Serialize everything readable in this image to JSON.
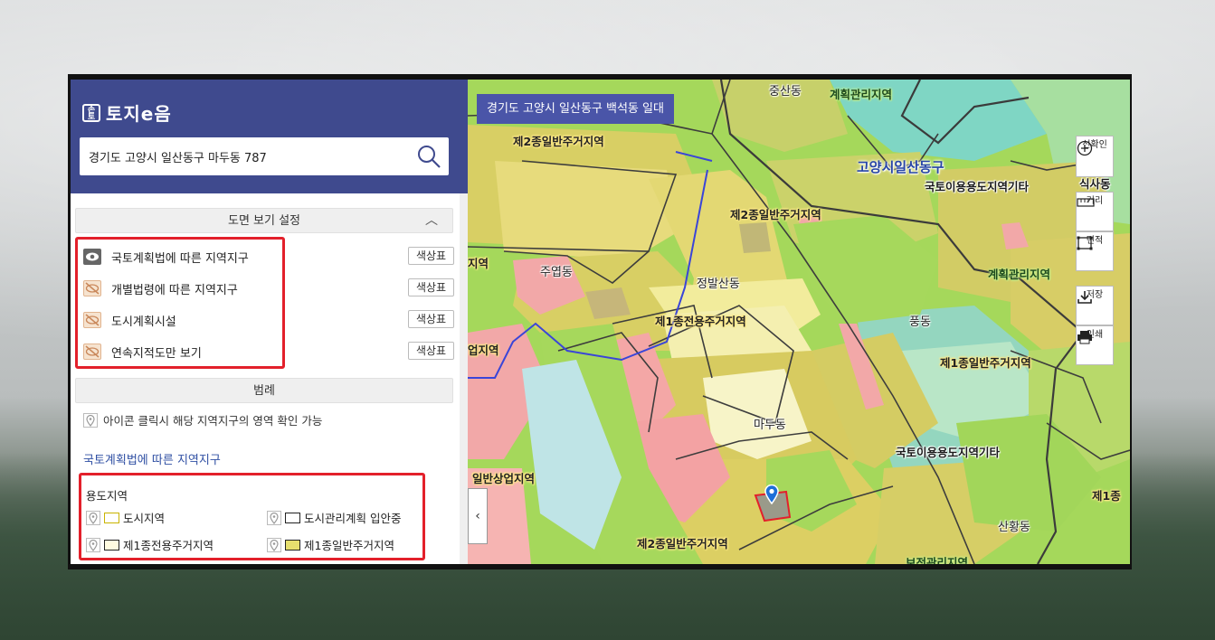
{
  "app": {
    "logo_text": "토지e음",
    "logo_mark": "손쉽\n토지"
  },
  "search": {
    "value": "경기도 고양시 일산동구 마두동 787",
    "icon": "search-icon"
  },
  "view_settings": {
    "title": "도면 보기 설정",
    "layers": [
      {
        "label": "국토계획법에 따른 지역지구",
        "visible": true,
        "button": "색상표"
      },
      {
        "label": "개별법령에 따른 지역지구",
        "visible": false,
        "button": "색상표"
      },
      {
        "label": "도시계획시설",
        "visible": false,
        "button": "색상표"
      },
      {
        "label": "연속지적도만 보기",
        "visible": false,
        "button": "색상표"
      }
    ]
  },
  "legend": {
    "title": "범례",
    "info": "아이콘 클릭시 해당 지역지구의 영역 확인 가능",
    "subheading": "국토계획법에 따른 지역지구",
    "group_title": "용도지역",
    "items": [
      {
        "label": "도시지역",
        "swatch": "#ffffff",
        "border": "#c9b400"
      },
      {
        "label": "도시관리계획 입안중",
        "swatch": "#ffffff",
        "border": "#222222"
      },
      {
        "label": "제1종전용주거지역",
        "swatch": "#fffbe0",
        "border": "#222222"
      },
      {
        "label": "제1종일반주거지역",
        "swatch": "#e6df6e",
        "border": "#222222"
      }
    ]
  },
  "map": {
    "title": "경기도 고양시 일산동구 백석동 일대",
    "tools": [
      {
        "label": "선확인",
        "icon": "plus-circle-icon"
      },
      {
        "label": "거리",
        "icon": "ruler-icon"
      },
      {
        "label": "면적",
        "icon": "area-icon"
      },
      {
        "label": "저장",
        "icon": "download-icon"
      },
      {
        "label": "인쇄",
        "icon": "printer-icon"
      }
    ],
    "collapse_icon": "chevron-left-icon",
    "labels": {
      "jungsan": "중산동",
      "gyehoek_top": "계획관리지역",
      "zone2_top": "제2종일반주거지역",
      "ilsan_dong_gu": "고양시일산동구",
      "seoksadong": "식사동",
      "national_land_top": "국토이용용도지역기타",
      "zone2_mid": "제2종일반주거지역",
      "juyeop": "주엽동",
      "jeongbalsan": "정발산동",
      "gyehoek_right": "계획관리지역",
      "zone1_exclusive": "제1종전용주거지역",
      "pungdong": "풍동",
      "zone1_general": "제1종일반주거지역",
      "left_cut": "지역",
      "left_cut2": "업지역",
      "madu": "마두동",
      "national_land_mid": "국토이용용도지역기타",
      "general_commercial": "일반상업지역",
      "zone1_right": "제1종",
      "sanhwang": "산황동",
      "zone2_bottom": "제2종일반주거지역",
      "nature_bottom": "보전관리지역"
    }
  },
  "colors": {
    "header": "#3f4a8e",
    "highlight_border": "#e3202b",
    "map_title_bg": "#4a55a8"
  }
}
